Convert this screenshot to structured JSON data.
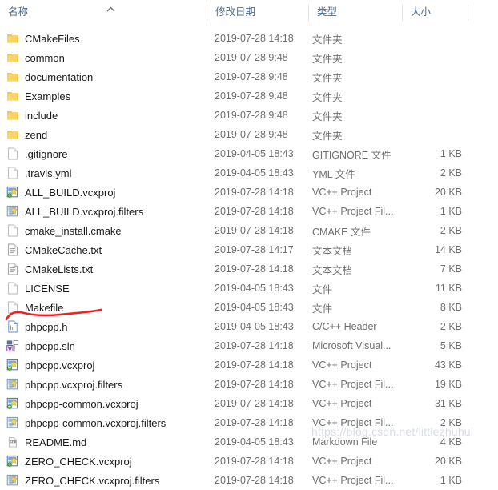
{
  "window": {
    "title": "File Explorer file list"
  },
  "header": {
    "columns": [
      {
        "label": "名称",
        "key": "name",
        "sorted": true,
        "sort_dir": "asc"
      },
      {
        "label": "修改日期",
        "key": "date"
      },
      {
        "label": "类型",
        "key": "type"
      },
      {
        "label": "大小",
        "key": "size"
      }
    ],
    "sort_icon": "chevron-up-icon",
    "text_color": "#4a6d91",
    "divider_color": "#e2e2e2"
  },
  "rows": [
    {
      "name": "CMakeFiles",
      "date": "2019-07-28 14:18",
      "type": "文件夹",
      "size": "",
      "icon": "folder-icon"
    },
    {
      "name": "common",
      "date": "2019-07-28 9:48",
      "type": "文件夹",
      "size": "",
      "icon": "folder-icon"
    },
    {
      "name": "documentation",
      "date": "2019-07-28 9:48",
      "type": "文件夹",
      "size": "",
      "icon": "folder-icon"
    },
    {
      "name": "Examples",
      "date": "2019-07-28 9:48",
      "type": "文件夹",
      "size": "",
      "icon": "folder-icon"
    },
    {
      "name": "include",
      "date": "2019-07-28 9:48",
      "type": "文件夹",
      "size": "",
      "icon": "folder-icon"
    },
    {
      "name": "zend",
      "date": "2019-07-28 9:48",
      "type": "文件夹",
      "size": "",
      "icon": "folder-icon"
    },
    {
      "name": ".gitignore",
      "date": "2019-04-05 18:43",
      "type": "GITIGNORE 文件",
      "size": "1 KB",
      "icon": "blank-file-icon"
    },
    {
      "name": ".travis.yml",
      "date": "2019-04-05 18:43",
      "type": "YML 文件",
      "size": "2 KB",
      "icon": "blank-file-icon"
    },
    {
      "name": "ALL_BUILD.vcxproj",
      "date": "2019-07-28 14:18",
      "type": "VC++ Project",
      "size": "20 KB",
      "icon": "vcxproj-icon"
    },
    {
      "name": "ALL_BUILD.vcxproj.filters",
      "date": "2019-07-28 14:18",
      "type": "VC++ Project Fil...",
      "size": "1 KB",
      "icon": "vcxproj-filters-icon"
    },
    {
      "name": "cmake_install.cmake",
      "date": "2019-07-28 14:18",
      "type": "CMAKE 文件",
      "size": "2 KB",
      "icon": "blank-file-icon"
    },
    {
      "name": "CMakeCache.txt",
      "date": "2019-07-28 14:17",
      "type": "文本文档",
      "size": "14 KB",
      "icon": "text-document-icon"
    },
    {
      "name": "CMakeLists.txt",
      "date": "2019-07-28 14:18",
      "type": "文本文档",
      "size": "7 KB",
      "icon": "text-document-icon"
    },
    {
      "name": "LICENSE",
      "date": "2019-04-05 18:43",
      "type": "文件",
      "size": "11 KB",
      "icon": "blank-file-icon"
    },
    {
      "name": "Makefile",
      "date": "2019-04-05 18:43",
      "type": "文件",
      "size": "8 KB",
      "icon": "blank-file-icon"
    },
    {
      "name": "phpcpp.h",
      "date": "2019-04-05 18:43",
      "type": "C/C++ Header",
      "size": "2 KB",
      "icon": "header-file-icon"
    },
    {
      "name": "phpcpp.sln",
      "date": "2019-07-28 14:18",
      "type": "Microsoft Visual...",
      "size": "5 KB",
      "icon": "visual-studio-solution-icon"
    },
    {
      "name": "phpcpp.vcxproj",
      "date": "2019-07-28 14:18",
      "type": "VC++ Project",
      "size": "43 KB",
      "icon": "vcxproj-icon"
    },
    {
      "name": "phpcpp.vcxproj.filters",
      "date": "2019-07-28 14:18",
      "type": "VC++ Project Fil...",
      "size": "19 KB",
      "icon": "vcxproj-filters-icon"
    },
    {
      "name": "phpcpp-common.vcxproj",
      "date": "2019-07-28 14:18",
      "type": "VC++ Project",
      "size": "31 KB",
      "icon": "vcxproj-icon"
    },
    {
      "name": "phpcpp-common.vcxproj.filters",
      "date": "2019-07-28 14:18",
      "type": "VC++ Project Fil...",
      "size": "2 KB",
      "icon": "vcxproj-filters-icon"
    },
    {
      "name": "README.md",
      "date": "2019-04-05 18:43",
      "type": "Markdown File",
      "size": "4 KB",
      "icon": "markdown-file-icon"
    },
    {
      "name": "ZERO_CHECK.vcxproj",
      "date": "2019-07-28 14:18",
      "type": "VC++ Project",
      "size": "20 KB",
      "icon": "vcxproj-icon"
    },
    {
      "name": "ZERO_CHECK.vcxproj.filters",
      "date": "2019-07-28 14:18",
      "type": "VC++ Project Fil...",
      "size": "1 KB",
      "icon": "vcxproj-filters-icon"
    }
  ],
  "annotation": {
    "target_row": "phpcpp.sln",
    "color": "#ee2222",
    "shape": "hand-drawn-underline"
  },
  "watermark": {
    "text": "https://blog.csdn.net/littlezhuhui",
    "color": "#d9dde3"
  }
}
